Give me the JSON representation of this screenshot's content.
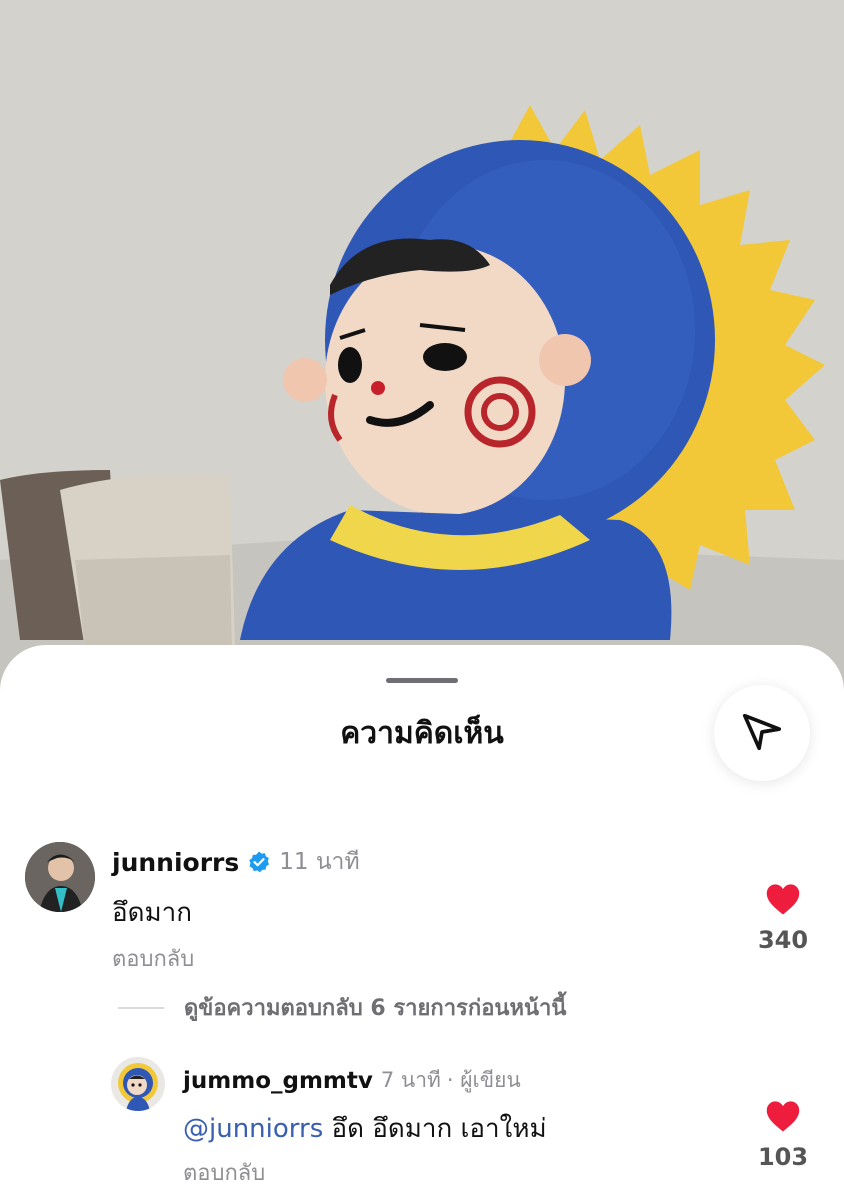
{
  "sheet": {
    "title": "ความคิดเห็น",
    "share_icon": "send-icon"
  },
  "comments": [
    {
      "username": "junniorrs",
      "verified": true,
      "time": "11 นาที",
      "text": "อึดมาก",
      "reply_label": "ตอบกลับ",
      "likes": "340"
    }
  ],
  "view_replies": "ดูข้อความตอบกลับ 6 รายการก่อนหน้านี้",
  "replies": [
    {
      "username": "jummo_gmmtv",
      "time": "7 นาที",
      "author_badge": "· ผู้เขียน",
      "mention": "@junniorrs",
      "text": " อึด อึดมาก เอาใหม่",
      "reply_label": "ตอบกลับ",
      "likes": "103"
    }
  ],
  "colors": {
    "heart": "#ee1d3e",
    "verified": "#1d9bf0",
    "mention": "#3a5fb0"
  }
}
